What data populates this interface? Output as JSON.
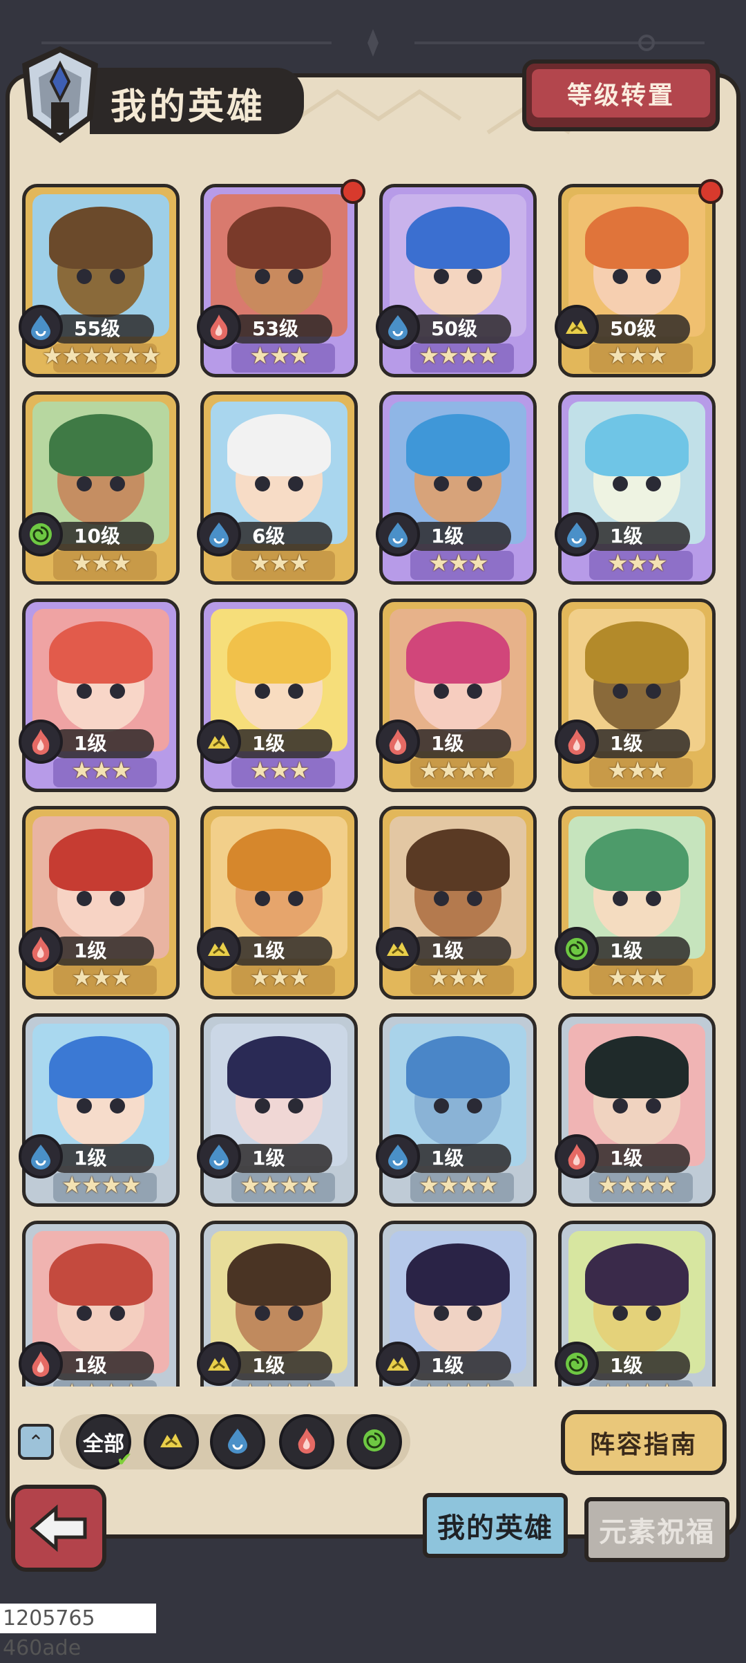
{
  "header": {
    "title": "我的英雄",
    "reset_label": "等级转置"
  },
  "colors": {
    "fire": "#e56a64",
    "water": "#4a90c8",
    "earth": "#e9cf4a",
    "wind": "#6ec843",
    "gold_card": "#e2b75a",
    "purple_card": "#b79be8",
    "silver_card": "#bfcbd6"
  },
  "heroes": [
    {
      "level": "55级",
      "stars": "★★★★★★",
      "element": "water",
      "frame": "gold",
      "alert": false
    },
    {
      "level": "53级",
      "stars": "★★★",
      "element": "fire",
      "frame": "purple",
      "alert": true
    },
    {
      "level": "50级",
      "stars": "★★★★",
      "element": "water",
      "frame": "purple",
      "alert": false
    },
    {
      "level": "50级",
      "stars": "★★★",
      "element": "earth",
      "frame": "gold",
      "alert": true
    },
    {
      "level": "10级",
      "stars": "★★★",
      "element": "wind",
      "frame": "gold",
      "alert": false
    },
    {
      "level": "6级",
      "stars": "★★★",
      "element": "water",
      "frame": "gold",
      "alert": false
    },
    {
      "level": "1级",
      "stars": "★★★",
      "element": "water",
      "frame": "purple",
      "alert": false
    },
    {
      "level": "1级",
      "stars": "★★★",
      "element": "water",
      "frame": "purple",
      "alert": false
    },
    {
      "level": "1级",
      "stars": "★★★",
      "element": "fire",
      "frame": "purple",
      "alert": false
    },
    {
      "level": "1级",
      "stars": "★★★",
      "element": "earth",
      "frame": "purple",
      "alert": false
    },
    {
      "level": "1级",
      "stars": "★★★★",
      "element": "fire",
      "frame": "gold",
      "alert": false
    },
    {
      "level": "1级",
      "stars": "★★★",
      "element": "fire",
      "frame": "gold",
      "alert": false
    },
    {
      "level": "1级",
      "stars": "★★★",
      "element": "fire",
      "frame": "gold",
      "alert": false
    },
    {
      "level": "1级",
      "stars": "★★★",
      "element": "earth",
      "frame": "gold",
      "alert": false
    },
    {
      "level": "1级",
      "stars": "★★★",
      "element": "earth",
      "frame": "gold",
      "alert": false
    },
    {
      "level": "1级",
      "stars": "★★★",
      "element": "wind",
      "frame": "gold",
      "alert": false
    },
    {
      "level": "1级",
      "stars": "★★★★",
      "element": "water",
      "frame": "silver",
      "alert": false
    },
    {
      "level": "1级",
      "stars": "★★★★",
      "element": "water",
      "frame": "silver",
      "alert": false
    },
    {
      "level": "1级",
      "stars": "★★★★",
      "element": "water",
      "frame": "silver",
      "alert": false
    },
    {
      "level": "1级",
      "stars": "★★★★",
      "element": "fire",
      "frame": "silver",
      "alert": false
    },
    {
      "level": "1级",
      "stars": "★★★★",
      "element": "fire",
      "frame": "silver",
      "alert": false
    },
    {
      "level": "1级",
      "stars": "★★★★",
      "element": "earth",
      "frame": "silver",
      "alert": false
    },
    {
      "level": "1级",
      "stars": "★★★★",
      "element": "earth",
      "frame": "silver",
      "alert": false
    },
    {
      "level": "1级",
      "stars": "★★★★",
      "element": "wind",
      "frame": "silver",
      "alert": false
    }
  ],
  "filters": {
    "all_label": "全部",
    "elements": [
      "earth",
      "water",
      "fire",
      "wind"
    ]
  },
  "guide_label": "阵容指南",
  "tabs": {
    "my_heroes": "我的英雄",
    "blessing": "元素祝福"
  },
  "footer_id": "1205765 460ade"
}
